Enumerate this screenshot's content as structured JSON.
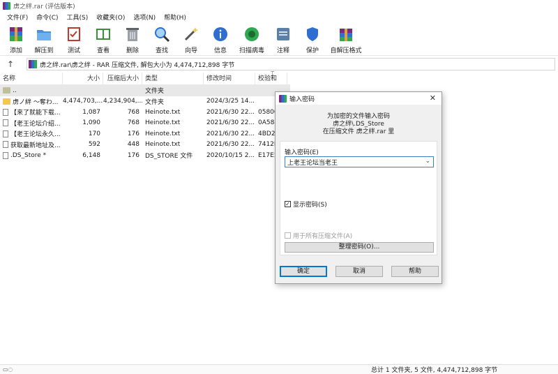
{
  "window": {
    "title": "虏之绊.rar (评估版本)"
  },
  "menu": [
    "文件(F)",
    "命令(C)",
    "工具(S)",
    "收藏夹(O)",
    "选项(N)",
    "帮助(H)"
  ],
  "toolbar": [
    {
      "label": "添加",
      "icon": "add-archive-icon"
    },
    {
      "label": "解压到",
      "icon": "extract-to-icon"
    },
    {
      "label": "测试",
      "icon": "test-icon"
    },
    {
      "label": "查看",
      "icon": "view-icon"
    },
    {
      "label": "删除",
      "icon": "delete-icon"
    },
    {
      "label": "查找",
      "icon": "find-icon"
    },
    {
      "label": "向导",
      "icon": "wizard-icon"
    },
    {
      "label": "信息",
      "icon": "info-icon"
    },
    {
      "label": "扫描病毒",
      "icon": "virus-scan-icon"
    },
    {
      "label": "注释",
      "icon": "comment-icon"
    },
    {
      "label": "保护",
      "icon": "protect-icon"
    },
    {
      "label": "自解压格式",
      "icon": "sfx-icon"
    }
  ],
  "address": {
    "path": "虏之绊.rar\\虏之绊 - RAR 压缩文件, 解包大小为 4,474,712,898 字节"
  },
  "columns": [
    "名称",
    "大小",
    "压缩后大小",
    "类型",
    "修改时间",
    "校验和"
  ],
  "files": [
    {
      "name": "..",
      "size": "",
      "packed": "",
      "type": "文件夹",
      "modified": "",
      "crc": "",
      "kind": "folder"
    },
    {
      "name": "虏ノ絆 ～奪わ...",
      "size": "4,474,703,...",
      "packed": "4,234,904,...",
      "type": "文件夹",
      "modified": "2024/3/25 14...",
      "crc": "",
      "kind": "folder"
    },
    {
      "name": "【来了就能下载...",
      "size": "1,087",
      "packed": "768",
      "type": "Heinote.txt",
      "modified": "2021/6/30 22...",
      "crc": "05800",
      "kind": "file"
    },
    {
      "name": "【老王论坛介绍...",
      "size": "1,090",
      "packed": "768",
      "type": "Heinote.txt",
      "modified": "2021/6/30 22...",
      "crc": "0A584",
      "kind": "file"
    },
    {
      "name": "【老王论坛永久...",
      "size": "170",
      "packed": "176",
      "type": "Heinote.txt",
      "modified": "2021/6/30 22...",
      "crc": "4BD2",
      "kind": "file"
    },
    {
      "name": "获取最新地址及...",
      "size": "592",
      "packed": "448",
      "type": "Heinote.txt",
      "modified": "2021/6/30 22...",
      "crc": "7412D",
      "kind": "file"
    },
    {
      "name": ".DS_Store *",
      "size": "6,148",
      "packed": "176",
      "type": "DS_STORE 文件",
      "modified": "2020/10/15 2...",
      "crc": "E17E5",
      "kind": "file"
    }
  ],
  "status": {
    "summary": "总计 1 文件夹, 5 文件, 4,474,712,898 字节"
  },
  "dialog": {
    "title": "输入密码",
    "info_line1": "为加密的文件输入密码",
    "info_line2": "虏之绊\\.DS_Store",
    "info_line3": "在压缩文件 虏之绊.rar 里",
    "password_label": "输入密码(E)",
    "password_value": "上老王论坛当老王",
    "show_password": "显示密码(S)",
    "use_for_all": "用于所有压缩文件(A)",
    "manage": "整理密码(O)...",
    "ok": "确定",
    "cancel": "取消",
    "help": "帮助"
  }
}
